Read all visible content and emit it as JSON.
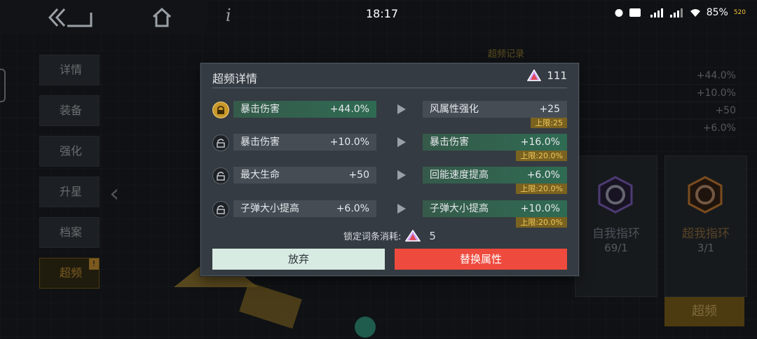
{
  "status_bar": {
    "time": "18:17",
    "battery": "85%",
    "speed": "520"
  },
  "side_menu": {
    "items": [
      {
        "label": "详情"
      },
      {
        "label": "装备"
      },
      {
        "label": "强化"
      },
      {
        "label": "升星"
      },
      {
        "label": "档案"
      },
      {
        "label": "超频",
        "active": true,
        "alert": "!"
      }
    ]
  },
  "nav": {
    "info_glyph": "i"
  },
  "background": {
    "record_title": "超频记录",
    "record_values": [
      "+44.0%",
      "+10.0%",
      "+50",
      "+6.0%"
    ],
    "rings": [
      {
        "name": "自我指环",
        "count": "69/1",
        "color": "#8d6bd0"
      },
      {
        "name": "超我指环",
        "count": "3/1",
        "color": "#e08a3a"
      }
    ],
    "overclock_button": "超频"
  },
  "modal": {
    "title": "超频详情",
    "currency_amount": "111",
    "rows": [
      {
        "locked": true,
        "old_name": "暴击伤害",
        "old_value": "+44.0%",
        "old_highlight": true,
        "new_name": "风属性强化",
        "new_value": "+25",
        "new_highlight": false,
        "limit": "上限:25"
      },
      {
        "locked": false,
        "old_name": "暴击伤害",
        "old_value": "+10.0%",
        "old_highlight": false,
        "new_name": "暴击伤害",
        "new_value": "+16.0%",
        "new_highlight": true,
        "limit": "上限:20.0%"
      },
      {
        "locked": false,
        "old_name": "最大生命",
        "old_value": "+50",
        "old_highlight": false,
        "new_name": "回能速度提高",
        "new_value": "+6.0%",
        "new_highlight": true,
        "limit": "上限:20.0%"
      },
      {
        "locked": false,
        "old_name": "子弹大小提高",
        "old_value": "+6.0%",
        "old_highlight": false,
        "new_name": "子弹大小提高",
        "new_value": "+10.0%",
        "new_highlight": true,
        "limit": "上限:20.0%"
      }
    ],
    "lock_cost_label": "锁定词条消耗:",
    "lock_cost_value": "5",
    "give_up_label": "放弃",
    "replace_label": "替换属性"
  },
  "colors": {
    "accent_gold": "#c9982a",
    "accent_green": "#2f6b53",
    "replace_red": "#ee4a3d",
    "give_up_mint": "#d8ebe2"
  }
}
